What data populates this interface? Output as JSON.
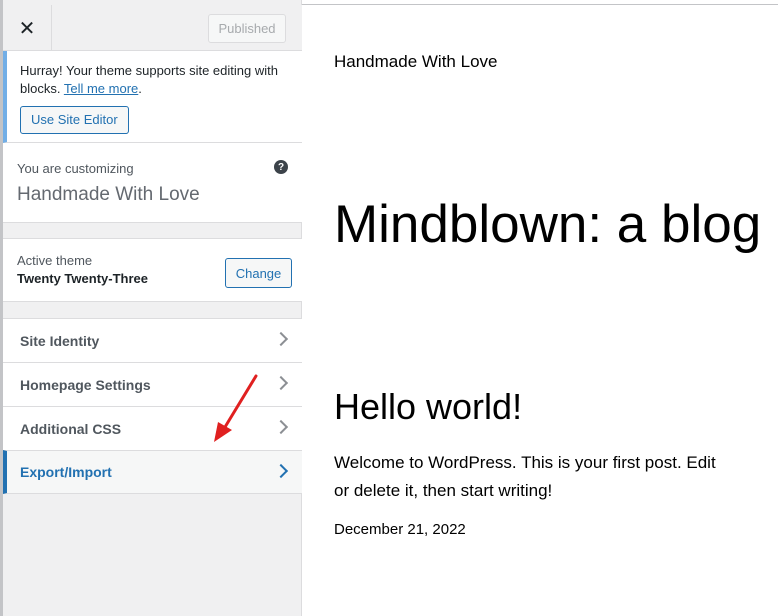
{
  "header": {
    "close_label": "✕",
    "published_label": "Published"
  },
  "notice": {
    "text": "Hurray! Your theme supports site editing with blocks.",
    "link": "Tell me more",
    "period": ".",
    "button": "Use Site Editor"
  },
  "customizing": {
    "label": "You are customizing",
    "site_name": "Handmade With Love",
    "help": "?"
  },
  "theme": {
    "label": "Active theme",
    "name": "Twenty Twenty-Three",
    "change_label": "Change"
  },
  "menu": {
    "items": [
      {
        "label": "Site Identity"
      },
      {
        "label": "Homepage Settings"
      },
      {
        "label": "Additional CSS"
      },
      {
        "label": "Export/Import"
      }
    ]
  },
  "preview": {
    "site_title": "Handmade With Love",
    "tagline": "Mindblown: a blog",
    "post_title": "Hello world!",
    "post_body": "Welcome to WordPress. This is your first post. Edit or delete it, then start writing!",
    "post_date": "December 21, 2022"
  },
  "colors": {
    "accent": "#2271b1",
    "notice_border": "#72aee6",
    "annotation_arrow": "#e02020"
  }
}
